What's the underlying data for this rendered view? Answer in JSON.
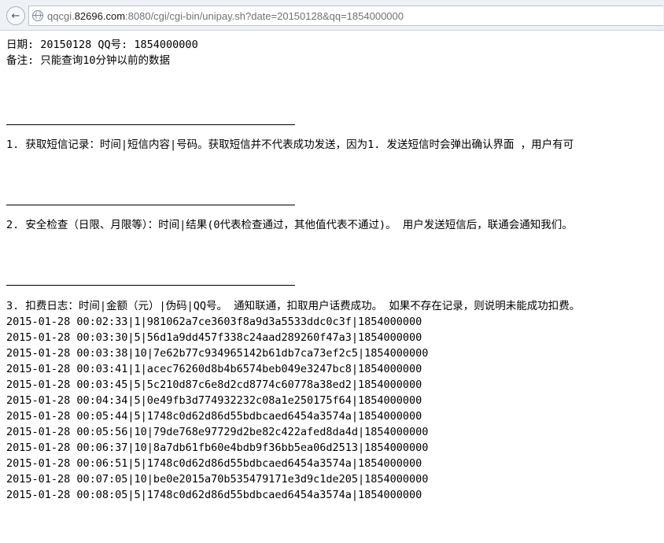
{
  "browser": {
    "url_prefix": "qqcgi.",
    "url_domain": "82696.com",
    "url_rest": ":8080/cgi/cgi-bin/unipay.sh?date=20150128&qq=1854000000"
  },
  "header": {
    "date_line": "日期: 20150128 QQ号: 1854000000",
    "note_line": "备注: 只能查询10分钟以前的数据"
  },
  "sections": [
    {
      "title": "1. 获取短信记录：时间|短信内容|号码。获取短信并不代表成功发送，因为1. 发送短信时会弹出确认界面 ，用户有可"
    },
    {
      "title": "2. 安全检查（日限、月限等）：时间|结果(0代表检查通过，其他值代表不通过)。 用户发送短信后，联通会通知我们。"
    },
    {
      "title": "3. 扣费日志：时间|金额（元）|伪码|QQ号。 通知联通，扣取用户话费成功。 如果不存在记录，则说明未能成功扣费。"
    }
  ],
  "log_rows": [
    "2015-01-28 00:02:33|1|981062a7ce3603f8a9d3a5533ddc0c3f|1854000000",
    "2015-01-28 00:03:30|5|56d1a9dd457f338c24aad289260f47a3|1854000000",
    "2015-01-28 00:03:38|10|7e62b77c934965142b61db7ca73ef2c5|1854000000",
    "2015-01-28 00:03:41|1|acec76260d8b4b6574beb049e3247bc8|1854000000",
    "2015-01-28 00:03:45|5|5c210d87c6e8d2cd8774c60778a38ed2|1854000000",
    "2015-01-28 00:04:34|5|0e49fb3d774932232c08a1e250175f64|1854000000",
    "2015-01-28 00:05:44|5|1748c0d62d86d55bdbcaed6454a3574a|1854000000",
    "2015-01-28 00:05:56|10|79de768e97729d2be82c422afed8da4d|1854000000",
    "2015-01-28 00:06:37|10|8a7db61fb60e4bdb9f36bb5ea06d2513|1854000000",
    "2015-01-28 00:06:51|5|1748c0d62d86d55bdbcaed6454a3574a|1854000000",
    "2015-01-28 00:07:05|10|be0e2015a70b535479171e3d9c1de205|1854000000",
    "2015-01-28 00:08:05|5|1748c0d62d86d55bdbcaed6454a3574a|1854000000"
  ]
}
